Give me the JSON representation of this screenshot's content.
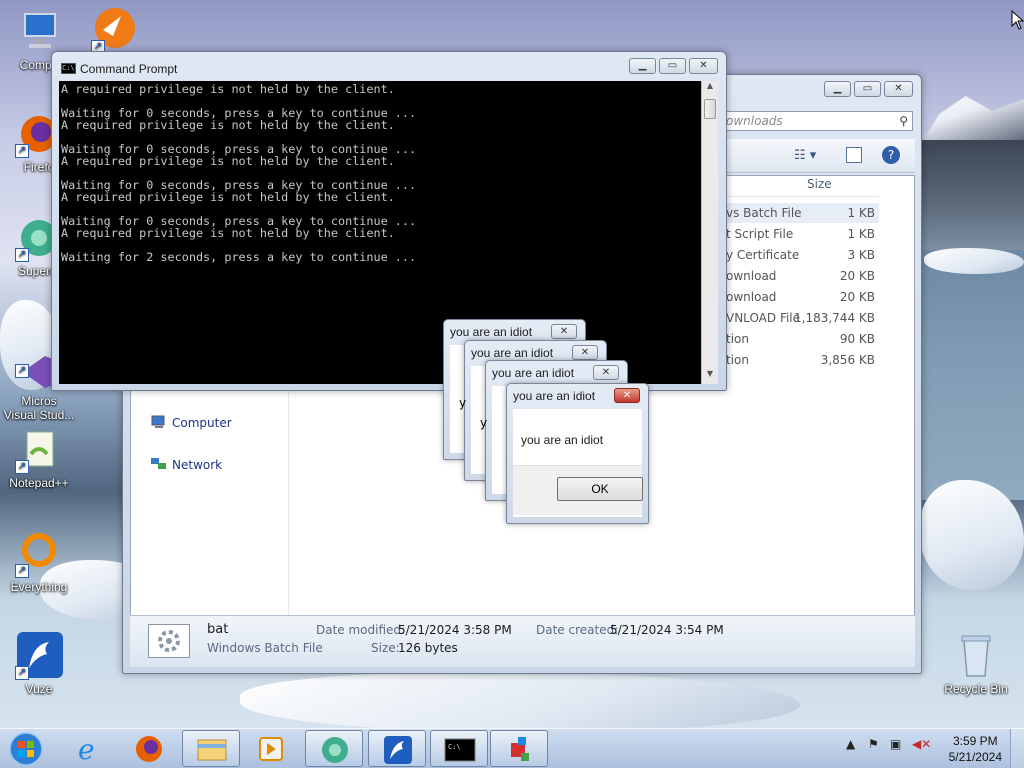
{
  "desktop": {
    "icons": [
      {
        "label": "Compu",
        "icon": "computer-icon"
      },
      {
        "label": "",
        "icon": "ccleaner-icon"
      },
      {
        "label": "Firefo",
        "icon": "firefox-icon"
      },
      {
        "label": "Superm",
        "icon": "supermium-icon"
      },
      {
        "label": "Micros\nVisual Stud...",
        "icon": "visual-studio-icon"
      },
      {
        "label": "Notepad++",
        "icon": "notepadpp-icon"
      },
      {
        "label": "Everything",
        "icon": "everything-icon"
      },
      {
        "label": "Vuze",
        "icon": "vuze-icon"
      },
      {
        "label": "Recycle Bin",
        "icon": "recycle-bin-icon"
      }
    ]
  },
  "explorer": {
    "search_placeholder": "ownloads",
    "column_size": "Size",
    "files": [
      {
        "name": "vs Batch File",
        "size": "1 KB"
      },
      {
        "name": "t Script File",
        "size": "1 KB"
      },
      {
        "name": "y Certificate",
        "size": "3 KB"
      },
      {
        "name": "ownload",
        "size": "20 KB"
      },
      {
        "name": "ownload",
        "size": "20 KB"
      },
      {
        "name": "VNLOAD File",
        "size": "1,183,744 KB"
      },
      {
        "name": "tion",
        "size": "90 KB"
      },
      {
        "name": "tion",
        "size": "3,856 KB"
      }
    ],
    "nav": [
      {
        "label": "Computer"
      },
      {
        "label": "Network"
      }
    ],
    "details": {
      "name": "bat",
      "type": "Windows Batch File",
      "modified_label": "Date modified:",
      "modified_value": "5/21/2024 3:58 PM",
      "created_label": "Date created:",
      "created_value": "5/21/2024 3:54 PM",
      "size_label": "Size:",
      "size_value": "126 bytes"
    }
  },
  "cmd": {
    "title": "Command Prompt",
    "output": "A required privilege is not held by the client.\n\nWaiting for 0 seconds, press a key to continue ...\nA required privilege is not held by the client.\n\nWaiting for 0 seconds, press a key to continue ...\nA required privilege is not held by the client.\n\nWaiting for 0 seconds, press a key to continue ...\nA required privilege is not held by the client.\n\nWaiting for 0 seconds, press a key to continue ...\nA required privilege is not held by the client.\n\nWaiting for 2 seconds, press a key to continue ..."
  },
  "msgboxes": [
    {
      "title": "you are an idiot",
      "peek": ""
    },
    {
      "title": "you are an idiot",
      "peek": "y"
    },
    {
      "title": "you are an idiot",
      "peek": "y"
    },
    {
      "title": "you are an idiot",
      "peek": "y"
    }
  ],
  "active_msgbox": {
    "title": "you are an idiot",
    "message": "you are an idiot",
    "ok": "OK"
  },
  "taskbar": {
    "clock_time": "3:59 PM",
    "clock_date": "5/21/2024"
  }
}
